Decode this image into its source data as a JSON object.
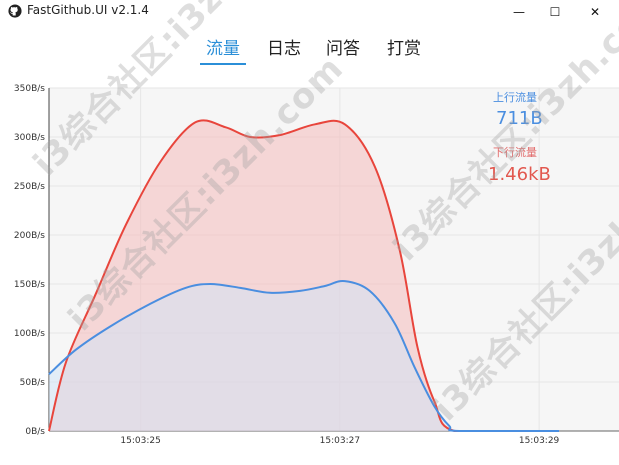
{
  "window": {
    "title": "FastGithub.UI v2.1.4",
    "minimize_glyph": "—",
    "maximize_glyph": "☐",
    "close_glyph": "✕"
  },
  "tabs": [
    {
      "label": "流量",
      "active": true
    },
    {
      "label": "日志",
      "active": false
    },
    {
      "label": "问答",
      "active": false
    },
    {
      "label": "打赏",
      "active": false
    }
  ],
  "stats": {
    "upload_label": "上行流量",
    "upload_value": "711B",
    "download_label": "下行流量",
    "download_value": "1.46kB"
  },
  "watermark_text": "i3综合社区:i3zh.com",
  "colors": {
    "accent": "#2b8fd8",
    "upload_line": "#4a8ee0",
    "download_line": "#e8453c",
    "upload_fill": "#cfe3f7",
    "download_fill": "#f4bcbc"
  },
  "chart_data": {
    "type": "area",
    "title": "",
    "xlabel": "",
    "ylabel": "",
    "ylim": [
      0,
      350
    ],
    "y_ticks": [
      "0B/s",
      "50B/s",
      "100B/s",
      "150B/s",
      "200B/s",
      "250B/s",
      "300B/s",
      "350B/s"
    ],
    "x_ticks": [
      {
        "label": "15:03:25",
        "t": 1
      },
      {
        "label": "15:03:27",
        "t": 3
      },
      {
        "label": "15:03:29",
        "t": 5
      }
    ],
    "xlim": [
      0.08,
      5.2
    ],
    "grid": true,
    "series": [
      {
        "name": "下行流量",
        "color": "#e8453c",
        "points": [
          [
            0.08,
            0
          ],
          [
            0.25,
            70
          ],
          [
            0.55,
            140
          ],
          [
            0.85,
            210
          ],
          [
            1.2,
            275
          ],
          [
            1.55,
            315
          ],
          [
            1.85,
            310
          ],
          [
            2.1,
            300
          ],
          [
            2.4,
            302
          ],
          [
            2.75,
            313
          ],
          [
            3.05,
            313
          ],
          [
            3.35,
            270
          ],
          [
            3.6,
            185
          ],
          [
            3.78,
            85
          ],
          [
            3.95,
            30
          ],
          [
            4.15,
            0
          ],
          [
            5.0,
            0
          ],
          [
            5.2,
            0
          ]
        ]
      },
      {
        "name": "上行流量",
        "color": "#4a8ee0",
        "points": [
          [
            0.08,
            58
          ],
          [
            0.35,
            83
          ],
          [
            0.7,
            107
          ],
          [
            1.1,
            130
          ],
          [
            1.45,
            146
          ],
          [
            1.7,
            150
          ],
          [
            2.0,
            146
          ],
          [
            2.3,
            141
          ],
          [
            2.6,
            143
          ],
          [
            2.85,
            148
          ],
          [
            3.05,
            153
          ],
          [
            3.3,
            143
          ],
          [
            3.55,
            110
          ],
          [
            3.75,
            65
          ],
          [
            3.95,
            25
          ],
          [
            4.1,
            5
          ],
          [
            4.2,
            0
          ],
          [
            5.2,
            0
          ]
        ]
      }
    ]
  }
}
